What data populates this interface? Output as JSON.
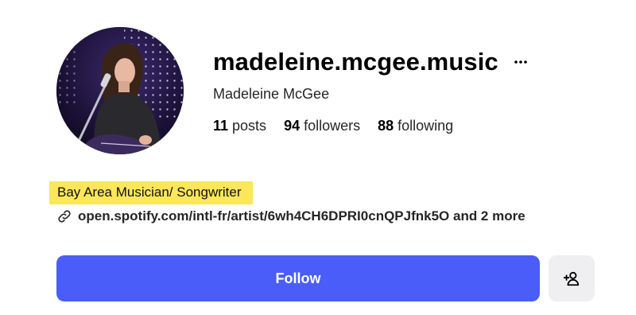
{
  "profile": {
    "username": "madeleine.mcgee.music",
    "full_name": "Madeleine McGee",
    "avatar_icon": "profile-photo",
    "more_icon": "more-horizontal-icon"
  },
  "stats": {
    "posts": {
      "count": "11",
      "label": "posts"
    },
    "followers": {
      "count": "94",
      "label": "followers"
    },
    "following": {
      "count": "88",
      "label": "following"
    }
  },
  "bio": {
    "text": "Bay Area Musician/ Songwriter",
    "highlight_color": "#fce65b"
  },
  "link": {
    "icon": "link-icon",
    "text": "open.spotify.com/intl-fr/artist/6wh4CH6DPRI0cnQPJfnk5O and 2 more"
  },
  "actions": {
    "follow_label": "Follow",
    "follow_color": "#4a5df9",
    "suggest_icon": "add-person-icon"
  }
}
